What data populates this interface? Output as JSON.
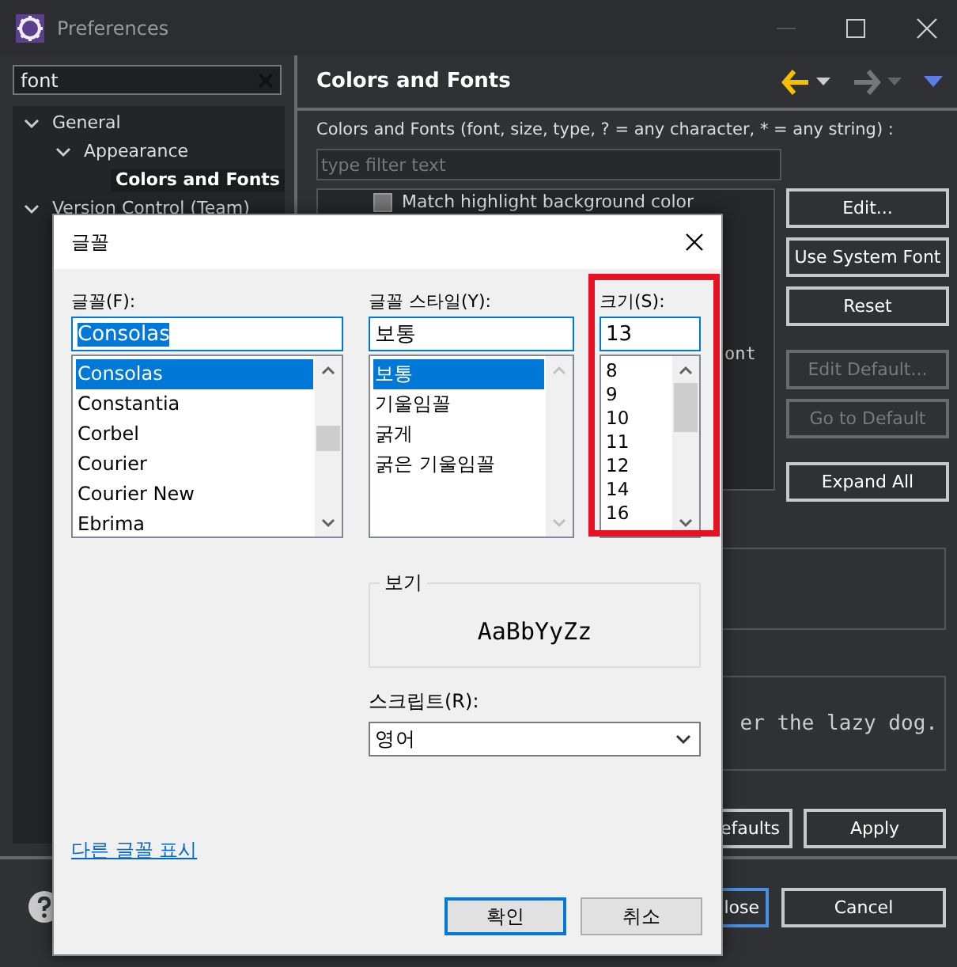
{
  "window": {
    "title": "Preferences"
  },
  "search": {
    "value": "font"
  },
  "tree": [
    {
      "label": "General",
      "expanded": true,
      "selected": false,
      "children": [
        {
          "label": "Appearance",
          "expanded": true,
          "selected": false,
          "children": [
            {
              "label": "Colors and Fonts",
              "selected": true
            }
          ]
        }
      ]
    },
    {
      "label": "Version Control (Team)",
      "expanded": true,
      "selected": false
    }
  ],
  "page": {
    "title": "Colors and Fonts",
    "description": "Colors and Fonts (font, size, type, ? = any character, * = any string) :",
    "filter": {
      "placeholder": "type filter text"
    },
    "items": [
      {
        "kind": "check",
        "label": "Match highlight background color",
        "checked": false
      },
      {
        "kind": "text",
        "label": "ont"
      }
    ],
    "buttons": [
      {
        "label": "Edit...",
        "disabled": false
      },
      {
        "label": "Use System Font",
        "disabled": false
      },
      {
        "label": "Reset",
        "disabled": false
      },
      {
        "label": "Edit Default...",
        "disabled": true
      },
      {
        "label": "Go to Default",
        "disabled": true
      },
      {
        "label": "Expand All",
        "disabled": false
      }
    ],
    "preview": "er the lazy dog.",
    "bottom_buttons": [
      "efaults",
      "Apply"
    ]
  },
  "footer": {
    "buttons": [
      "lose",
      "Cancel"
    ]
  },
  "dialog": {
    "title": "글꼴",
    "font": {
      "label": "글꼴(F):",
      "value": "Consolas",
      "options": [
        {
          "label": "Consolas",
          "selected": true
        },
        {
          "label": "Constantia",
          "selected": false
        },
        {
          "label": "Corbel",
          "selected": false
        },
        {
          "label": "Courier",
          "selected": false
        },
        {
          "label": "Courier New",
          "selected": false
        },
        {
          "label": "Ebrima",
          "selected": false
        }
      ]
    },
    "style": {
      "label": "글꼴 스타일(Y):",
      "value": "보통",
      "options": [
        {
          "label": "보통",
          "selected": true
        },
        {
          "label": "기울임꼴",
          "selected": false
        },
        {
          "label": "굵게",
          "selected": false
        },
        {
          "label": "굵은 기울임꼴",
          "selected": false
        }
      ]
    },
    "size": {
      "label": "크기(S):",
      "value": "13",
      "highlighted": true,
      "options": [
        {
          "label": "8",
          "selected": false
        },
        {
          "label": "9",
          "selected": false
        },
        {
          "label": "10",
          "selected": false
        },
        {
          "label": "11",
          "selected": false
        },
        {
          "label": "12",
          "selected": false
        },
        {
          "label": "14",
          "selected": false
        },
        {
          "label": "16",
          "selected": false
        }
      ]
    },
    "sample": {
      "label": "보기",
      "text": "AaBbYyZz"
    },
    "script": {
      "label": "스크립트(R):",
      "value": "영어"
    },
    "link": "다른 글꼴 표시",
    "buttons": [
      {
        "label": "확인",
        "default": true
      },
      {
        "label": "취소",
        "default": false
      }
    ]
  }
}
